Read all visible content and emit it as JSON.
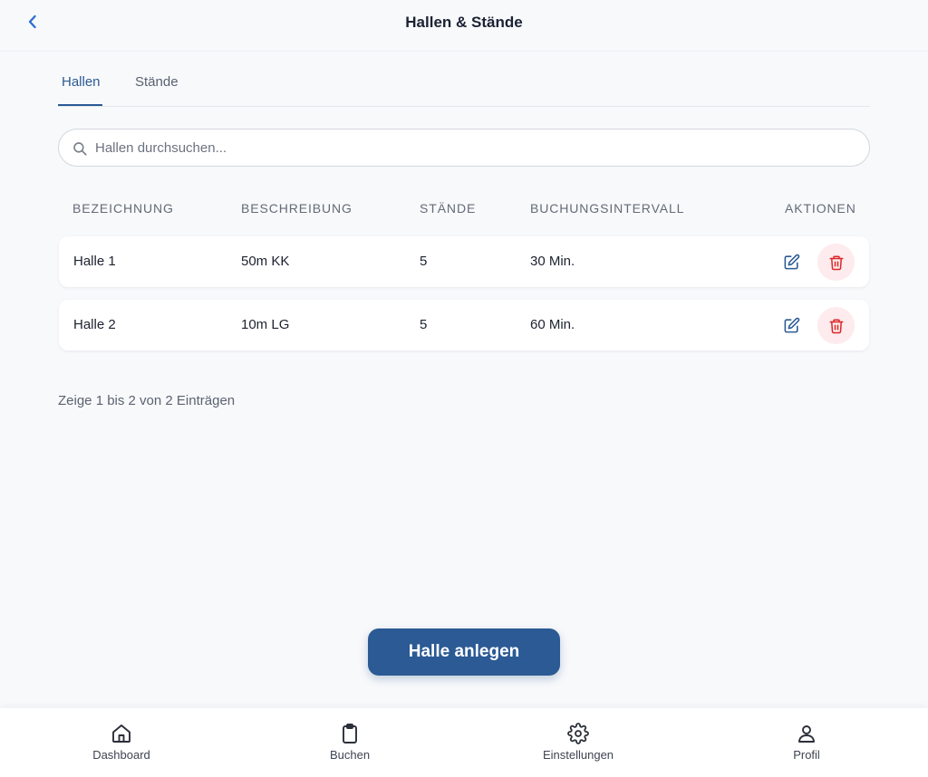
{
  "header": {
    "title": "Hallen & Stände",
    "back_icon": "chevron-left-icon"
  },
  "tabs": [
    {
      "label": "Hallen",
      "active": true
    },
    {
      "label": "Stände",
      "active": false
    }
  ],
  "search": {
    "placeholder": "Hallen durchsuchen...",
    "value": ""
  },
  "table": {
    "columns": [
      "BEZEICHNUNG",
      "BESCHREIBUNG",
      "STÄNDE",
      "BUCHUNGSINTERVALL",
      "AKTIONEN"
    ],
    "rows": [
      {
        "name": "Halle 1",
        "description": "50m KK",
        "stands": "5",
        "interval": "30 Min."
      },
      {
        "name": "Halle 2",
        "description": "10m LG",
        "stands": "5",
        "interval": "60 Min."
      }
    ]
  },
  "summary": "Zeige 1 bis 2 von 2 Einträgen",
  "primary_button": "Halle anlegen",
  "bottom_nav": [
    {
      "label": "Dashboard",
      "icon": "home-icon"
    },
    {
      "label": "Buchen",
      "icon": "clipboard-icon"
    },
    {
      "label": "Einstellungen",
      "icon": "gear-icon"
    },
    {
      "label": "Profil",
      "icon": "user-icon"
    }
  ],
  "colors": {
    "primary": "#2b5a94",
    "back_arrow": "#2f6fd6",
    "danger": "#dc2626",
    "danger_bg": "#fdebee",
    "background": "#f8f9fb"
  }
}
